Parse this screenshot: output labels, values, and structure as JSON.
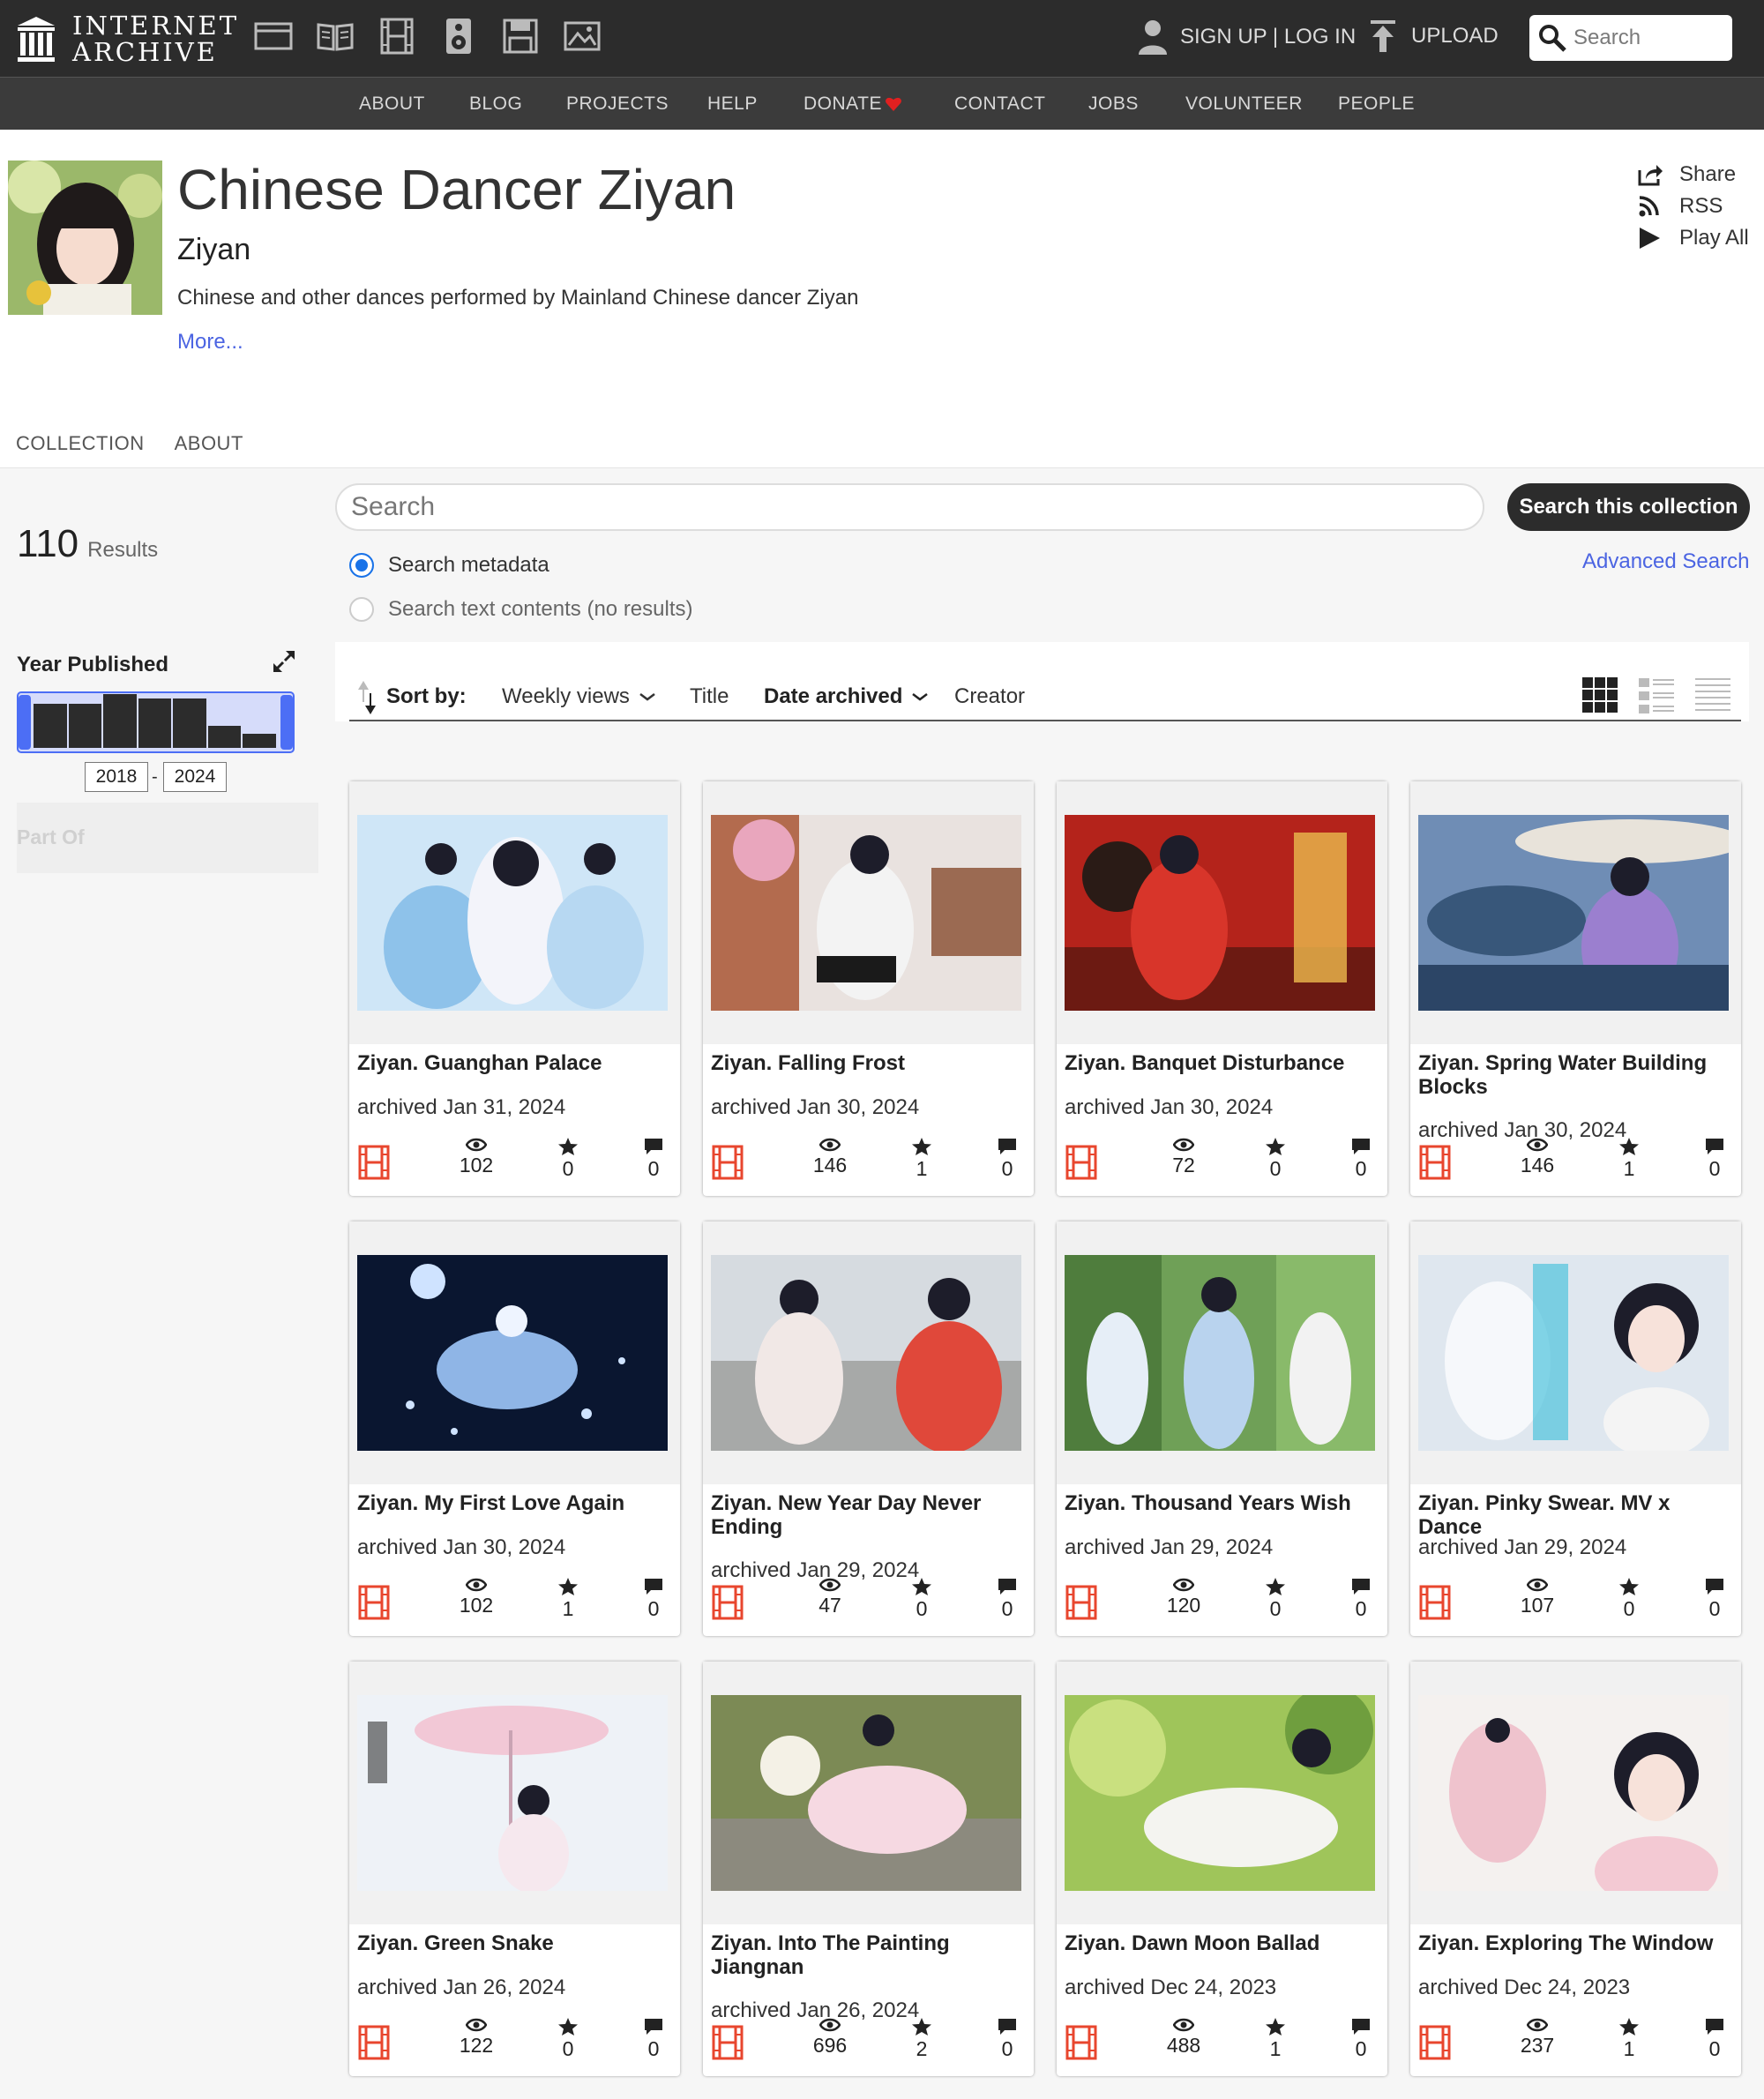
{
  "topbar": {
    "logo": {
      "line1": "INTERNET",
      "line2": "ARCHIVE"
    },
    "media_icons": [
      "web-icon",
      "texts-icon",
      "video-icon",
      "audio-icon",
      "software-icon",
      "images-icon"
    ],
    "signup_label": "SIGN UP | LOG IN",
    "upload_label": "UPLOAD",
    "search_placeholder": "Search"
  },
  "nav": {
    "items": [
      {
        "label": "ABOUT"
      },
      {
        "label": "BLOG"
      },
      {
        "label": "PROJECTS"
      },
      {
        "label": "HELP"
      },
      {
        "label": "DONATE"
      },
      {
        "label": "CONTACT"
      },
      {
        "label": "JOBS"
      },
      {
        "label": "VOLUNTEER"
      },
      {
        "label": "PEOPLE"
      }
    ]
  },
  "collection": {
    "title": "Chinese Dancer Ziyan",
    "creator": "Ziyan",
    "description": "Chinese and other dances performed by Mainland Chinese dancer Ziyan",
    "more": "More...",
    "actions": {
      "share": "Share",
      "rss": "RSS",
      "play_all": "Play All"
    }
  },
  "tabs": [
    {
      "label": "COLLECTION",
      "active": true
    },
    {
      "label": "ABOUT",
      "active": false
    }
  ],
  "sidebar": {
    "results_count": "110",
    "results_label": "Results",
    "year_published": "Year Published",
    "year_from": "2018",
    "year_to": "2024",
    "histogram": [
      0.55,
      0.55,
      0.68,
      0.62,
      0.62,
      0.28,
      0.18
    ],
    "part_of": "Part Of"
  },
  "search": {
    "placeholder": "Search",
    "button": "Search this collection",
    "advanced": "Advanced Search",
    "option_metadata": "Search metadata",
    "option_text": "Search text contents (no results)"
  },
  "sort": {
    "label": "Sort by:",
    "options": [
      {
        "label": "Weekly views",
        "active": false,
        "chevron": true
      },
      {
        "label": "Title",
        "active": false,
        "chevron": false
      },
      {
        "label": "Date archived",
        "active": true,
        "chevron": true
      },
      {
        "label": "Creator",
        "active": false,
        "chevron": false
      }
    ],
    "views": [
      "tile-view-icon",
      "list-detail-view-icon",
      "list-compact-view-icon"
    ]
  },
  "colors": {
    "accent": "#4b64e2",
    "dark": "#2c2c2c",
    "film": "#e8462e"
  },
  "items": [
    {
      "title": "Ziyan. Guanghan Palace",
      "date": "archived Jan 31, 2024",
      "views": "102",
      "favs": "0",
      "reviews": "0"
    },
    {
      "title": "Ziyan. Falling Frost",
      "date": "archived Jan 30, 2024",
      "views": "146",
      "favs": "1",
      "reviews": "0"
    },
    {
      "title": "Ziyan. Banquet Disturbance",
      "date": "archived Jan 30, 2024",
      "views": "72",
      "favs": "0",
      "reviews": "0"
    },
    {
      "title": "Ziyan. Spring Water Building Blocks",
      "date": "archived Jan 30, 2024",
      "views": "146",
      "favs": "1",
      "reviews": "0"
    },
    {
      "title": "Ziyan. My First Love Again",
      "date": "archived Jan 30, 2024",
      "views": "102",
      "favs": "1",
      "reviews": "0"
    },
    {
      "title": "Ziyan. New Year Day Never Ending",
      "date": "archived Jan 29, 2024",
      "views": "47",
      "favs": "0",
      "reviews": "0"
    },
    {
      "title": "Ziyan. Thousand Years Wish",
      "date": "archived Jan 29, 2024",
      "views": "120",
      "favs": "0",
      "reviews": "0"
    },
    {
      "title": "Ziyan. Pinky Swear. MV x Dance",
      "date": "archived Jan 29, 2024",
      "views": "107",
      "favs": "0",
      "reviews": "0"
    },
    {
      "title": "Ziyan. Green Snake",
      "date": "archived Jan 26, 2024",
      "views": "122",
      "favs": "0",
      "reviews": "0"
    },
    {
      "title": "Ziyan. Into The Painting Jiangnan",
      "date": "archived Jan 26, 2024",
      "views": "696",
      "favs": "2",
      "reviews": "0"
    },
    {
      "title": "Ziyan. Dawn Moon Ballad",
      "date": "archived Dec 24, 2023",
      "views": "488",
      "favs": "1",
      "reviews": "0"
    },
    {
      "title": "Ziyan. Exploring The Window",
      "date": "archived Dec 24, 2023",
      "views": "237",
      "favs": "1",
      "reviews": "0"
    }
  ]
}
